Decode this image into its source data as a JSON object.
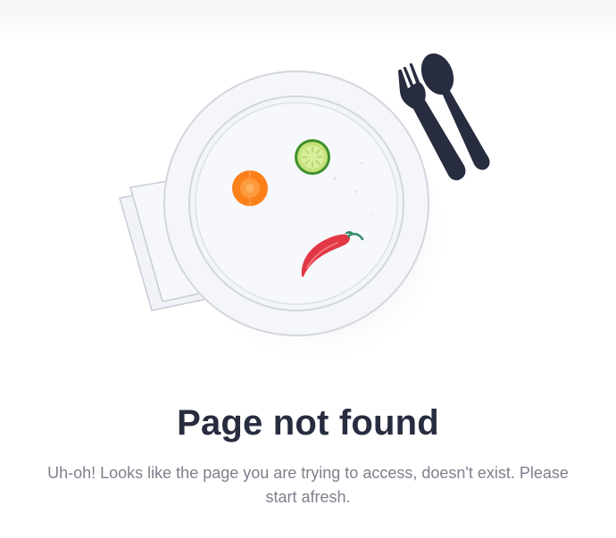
{
  "error_page": {
    "title": "Page not found",
    "message": "Uh-oh! Looks like the page you are trying to access, doesn't exist. Please start afresh."
  },
  "colors": {
    "title": "#282c3f",
    "message": "#7e808c",
    "cutlery": "#282c3f",
    "carrot": "#fc8019",
    "cucumber": "#a7d34d",
    "chili": "#e23744"
  },
  "illustration": {
    "name": "empty-plate-sad-face",
    "icons": [
      "plate-icon",
      "napkin-icon",
      "fork-icon",
      "spoon-icon",
      "carrot-slice-icon",
      "cucumber-slice-icon",
      "chili-pepper-icon"
    ]
  }
}
